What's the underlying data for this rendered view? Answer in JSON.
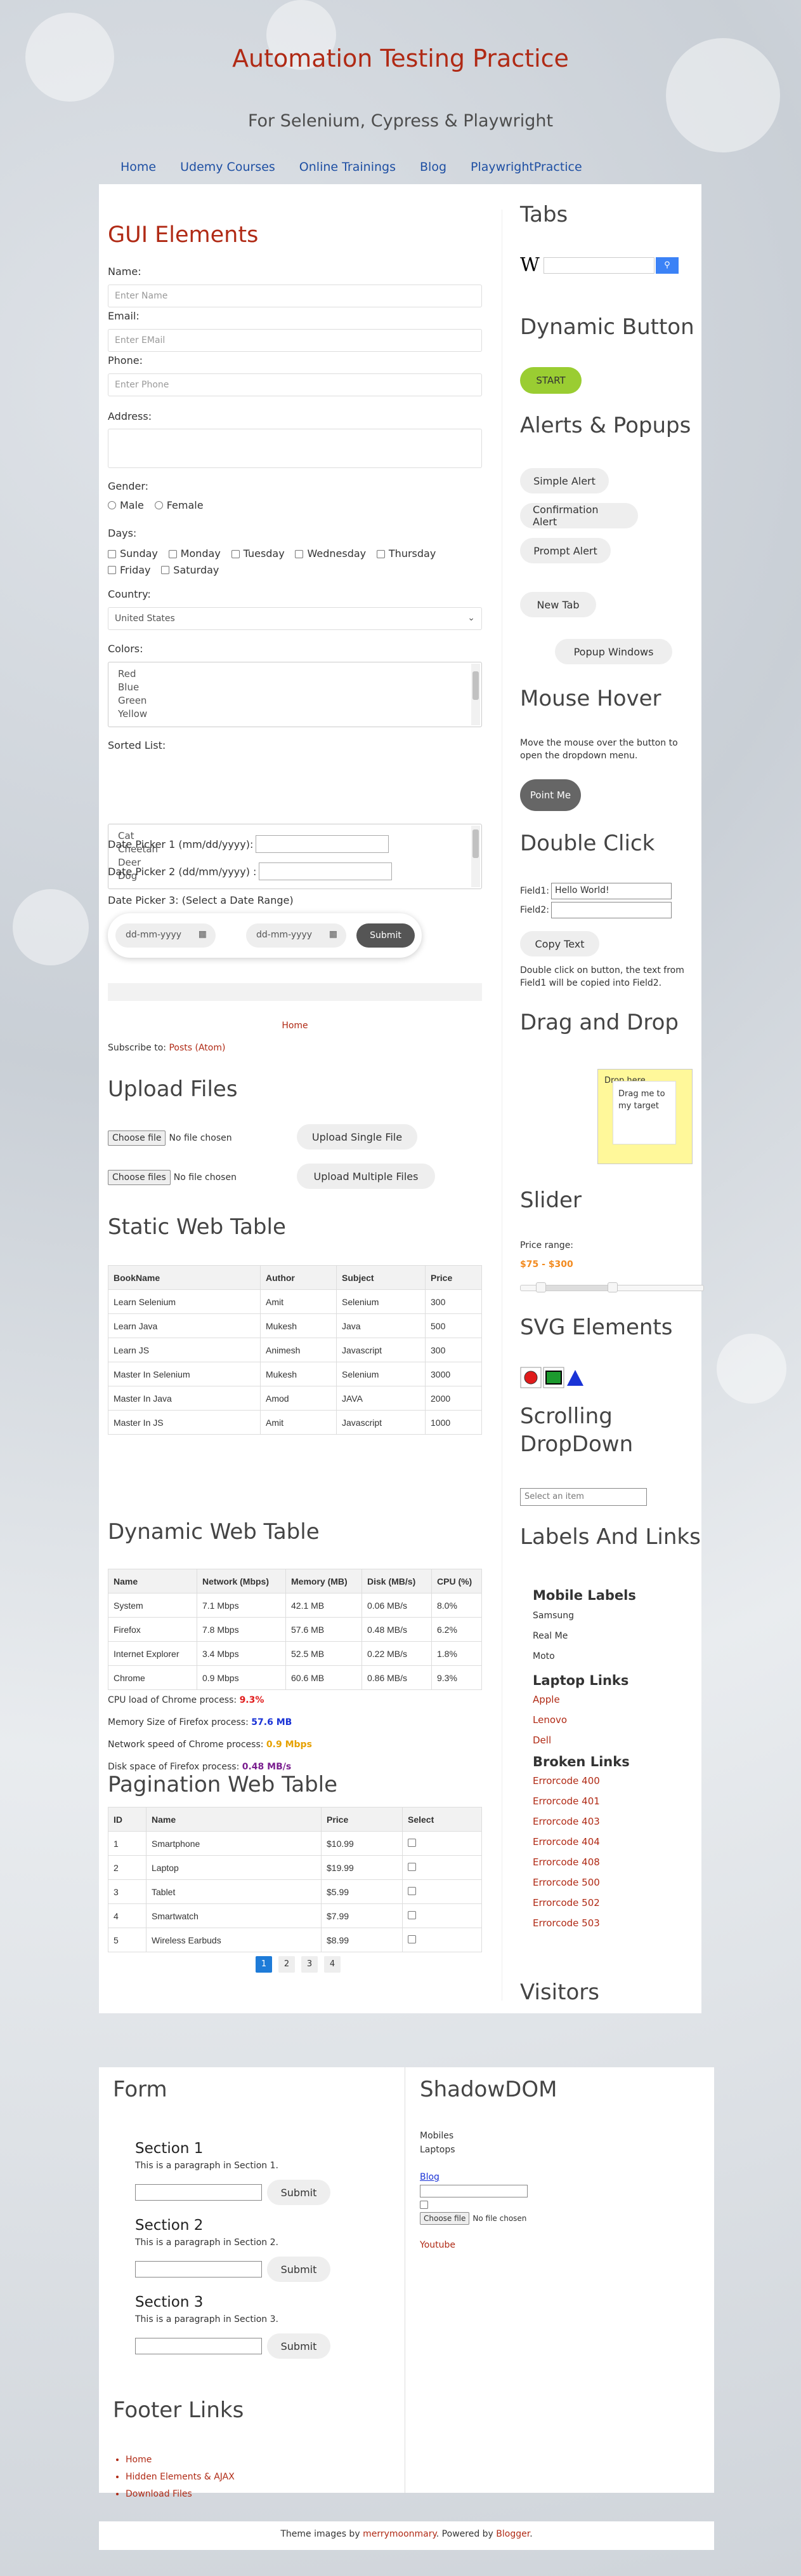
{
  "header": {
    "title": "Automation Testing Practice",
    "description": "For Selenium, Cypress & Playwright",
    "nav": [
      "Home",
      "Udemy Courses",
      "Online Trainings",
      "Blog",
      "PlaywrightPractice"
    ]
  },
  "gui": {
    "title": "GUI Elements",
    "name_label": "Name:",
    "name_placeholder": "Enter Name",
    "email_label": "Email:",
    "email_placeholder": "Enter EMail",
    "phone_label": "Phone:",
    "phone_placeholder": "Enter Phone",
    "address_label": "Address:",
    "gender_label": "Gender:",
    "male": "Male",
    "female": "Female",
    "days_label": "Days:",
    "days": [
      "Sunday",
      "Monday",
      "Tuesday",
      "Wednesday",
      "Thursday",
      "Friday",
      "Saturday"
    ],
    "country_label": "Country:",
    "country_value": "United States",
    "colors_label": "Colors:",
    "colors": [
      "Red",
      "Blue",
      "Green",
      "Yellow"
    ],
    "sorted_label": "Sorted List:",
    "animals": [
      "Cat",
      "Cheetah",
      "Deer",
      "Dog"
    ],
    "dp1_label": "Date Picker 1 (mm/dd/yyyy):",
    "dp2_label": "Date Picker 2 (dd/mm/yyyy) :",
    "dp3_label": "Date Picker 3: (Select a Date Range)",
    "date_placeholder": "dd-mm-yyyy",
    "submit": "Submit",
    "home_link": "Home",
    "subscribe_text": "Subscribe to: ",
    "subscribe_link": "Posts (Atom)"
  },
  "upload": {
    "title": "Upload Files",
    "choose_file": "Choose file",
    "no_file": "No file chosen",
    "upload_single": "Upload Single File",
    "choose_files": "Choose files",
    "no_files": "No file chosen",
    "upload_multiple": "Upload Multiple Files"
  },
  "static_table": {
    "title": "Static Web Table",
    "headers": [
      "BookName",
      "Author",
      "Subject",
      "Price"
    ],
    "rows": [
      [
        "Learn Selenium",
        "Amit",
        "Selenium",
        "300"
      ],
      [
        "Learn Java",
        "Mukesh",
        "Java",
        "500"
      ],
      [
        "Learn JS",
        "Animesh",
        "Javascript",
        "300"
      ],
      [
        "Master In Selenium",
        "Mukesh",
        "Selenium",
        "3000"
      ],
      [
        "Master In Java",
        "Amod",
        "JAVA",
        "2000"
      ],
      [
        "Master In JS",
        "Amit",
        "Javascript",
        "1000"
      ]
    ]
  },
  "dynamic_table": {
    "title": "Dynamic Web Table",
    "headers": [
      "Name",
      "Network (Mbps)",
      "Memory (MB)",
      "Disk (MB/s)",
      "CPU (%)"
    ],
    "rows": [
      [
        "System",
        "7.1 Mbps",
        "42.1 MB",
        "0.06 MB/s",
        "8.0%"
      ],
      [
        "Firefox",
        "7.8 Mbps",
        "57.6 MB",
        "0.48 MB/s",
        "6.2%"
      ],
      [
        "Internet Explorer",
        "3.4 Mbps",
        "52.5 MB",
        "0.22 MB/s",
        "1.8%"
      ],
      [
        "Chrome",
        "0.9 Mbps",
        "60.6 MB",
        "0.86 MB/s",
        "9.3%"
      ]
    ],
    "stats": [
      {
        "label": "CPU load of Chrome process: ",
        "value": "9.3%",
        "color": "#e01b1b"
      },
      {
        "label": "Memory Size of Firefox process: ",
        "value": "57.6 MB",
        "color": "#1a33d6"
      },
      {
        "label": "Network speed of Chrome process: ",
        "value": "0.9 Mbps",
        "color": "#e6a100"
      },
      {
        "label": "Disk space of Firefox process: ",
        "value": "0.48 MB/s",
        "color": "#7a1f8f"
      }
    ]
  },
  "pagination_table": {
    "title": "Pagination Web Table",
    "headers": [
      "ID",
      "Name",
      "Price",
      "Select"
    ],
    "rows": [
      [
        "1",
        "Smartphone",
        "$10.99"
      ],
      [
        "2",
        "Laptop",
        "$19.99"
      ],
      [
        "3",
        "Tablet",
        "$5.99"
      ],
      [
        "4",
        "Smartwatch",
        "$7.99"
      ],
      [
        "5",
        "Wireless Earbuds",
        "$8.99"
      ]
    ],
    "pages": [
      "1",
      "2",
      "3",
      "4"
    ]
  },
  "right": {
    "tabs_title": "Tabs",
    "wiki_logo": "W",
    "dynamic_title": "Dynamic Button",
    "start": "START",
    "alerts_title": "Alerts & Popups",
    "simple_alert": "Simple Alert",
    "confirm_alert": "Confirmation Alert",
    "prompt_alert": "Prompt Alert",
    "new_tab": "New Tab",
    "popup": "Popup Windows",
    "hover_title": "Mouse Hover",
    "hover_text": "Move the mouse over the button to open the dropdown menu.",
    "point_me": "Point Me",
    "dbl_title": "Double Click",
    "field1_label": "Field1:",
    "field1_value": "Hello World!",
    "field2_label": "Field2:",
    "copy_text": "Copy Text",
    "dbl_desc": "Double click on button, the text from Field1 will be copied into Field2.",
    "drag_title": "Drag and Drop",
    "drop_label": "Drop here",
    "drag_text": "Drag me to my target",
    "slider_title": "Slider",
    "price_label": "Price range:",
    "price_value": "$75 - $300",
    "slider_range": [
      0.11,
      0.5
    ],
    "svg_title": "SVG Elements",
    "scroll_title": "Scrolling DropDown",
    "scroll_placeholder": "Select an item",
    "labels_title": "Labels And Links",
    "mobile_title": "Mobile Labels",
    "mobiles": [
      "Samsung",
      "Real Me",
      "Moto"
    ],
    "laptop_title": "Laptop Links",
    "laptops": [
      "Apple",
      "Lenovo",
      "Dell"
    ],
    "broken_title": "Broken Links",
    "broken": [
      "Errorcode 400",
      "Errorcode 401",
      "Errorcode 403",
      "Errorcode 404",
      "Errorcode 408",
      "Errorcode 500",
      "Errorcode 502",
      "Errorcode 503"
    ],
    "visitors_title": "Visitors"
  },
  "footer": {
    "form_title": "Form",
    "sections": [
      {
        "title": "Section 1",
        "text": "This is a paragraph in Section 1."
      },
      {
        "title": "Section 2",
        "text": "This is a paragraph in Section 2."
      },
      {
        "title": "Section 3",
        "text": "This is a paragraph in Section 3."
      }
    ],
    "submit": "Submit",
    "links_title": "Footer Links",
    "links": [
      "Home",
      "Hidden Elements & AJAX",
      "Download Files"
    ],
    "shadow_title": "ShadowDOM",
    "shadow_mobiles": "Mobiles",
    "shadow_laptops": "Laptops",
    "shadow_blog": "Blog",
    "choose_file": "Choose file",
    "no_file": "No file chosen",
    "youtube": "Youtube"
  },
  "attribution": {
    "pre": "Theme images by ",
    "author": "merrymoonmary",
    "mid": ". Powered by ",
    "blogger": "Blogger",
    "post": "."
  },
  "colors": {
    "accent": "#b02a15",
    "start_button": "#9acd32",
    "active_page": "#1e7bd8",
    "wiki_search": "#3b82f6",
    "drop_zone": "#fff89a"
  }
}
